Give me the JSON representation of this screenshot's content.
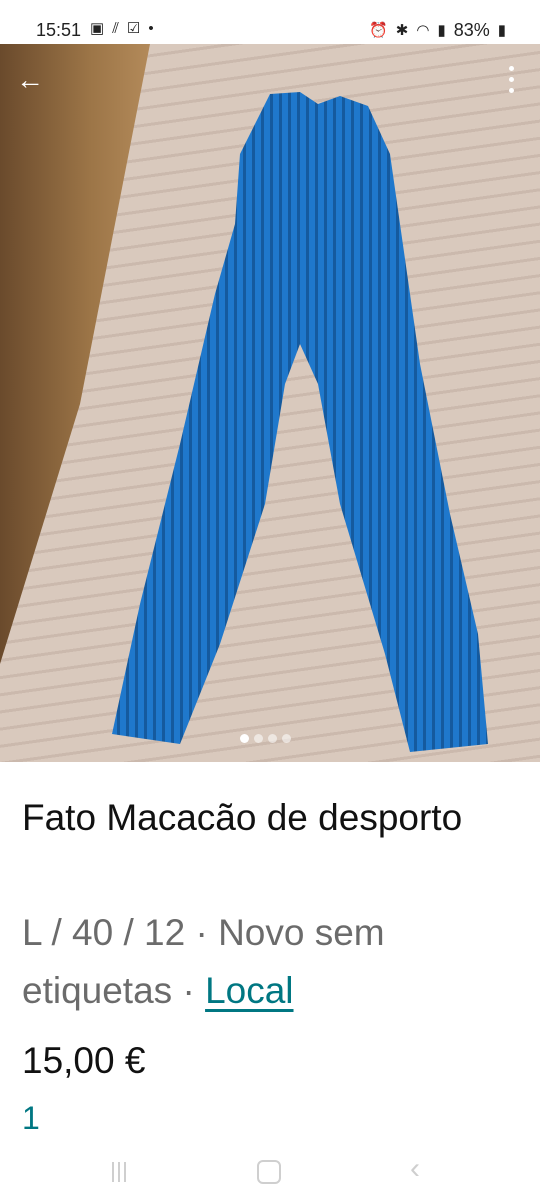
{
  "status": {
    "time": "15:51",
    "left_icons": [
      "image-icon",
      "cast-icon",
      "checkbox-icon",
      "dot-icon"
    ],
    "right_icons": [
      "alarm-icon",
      "bluetooth-icon",
      "wifi-icon",
      "signal-icon"
    ],
    "battery": "83%"
  },
  "gallery": {
    "photo_count": 4,
    "active_index": 0
  },
  "listing": {
    "title": "Fato Macacão de desporto",
    "details": "L / 40 / 12 · Novo sem etiquetas · ",
    "location_link": "Local",
    "price": "15,00 €",
    "count": "1"
  },
  "colors": {
    "accent": "#007782",
    "garment": "#1a6fc4"
  }
}
